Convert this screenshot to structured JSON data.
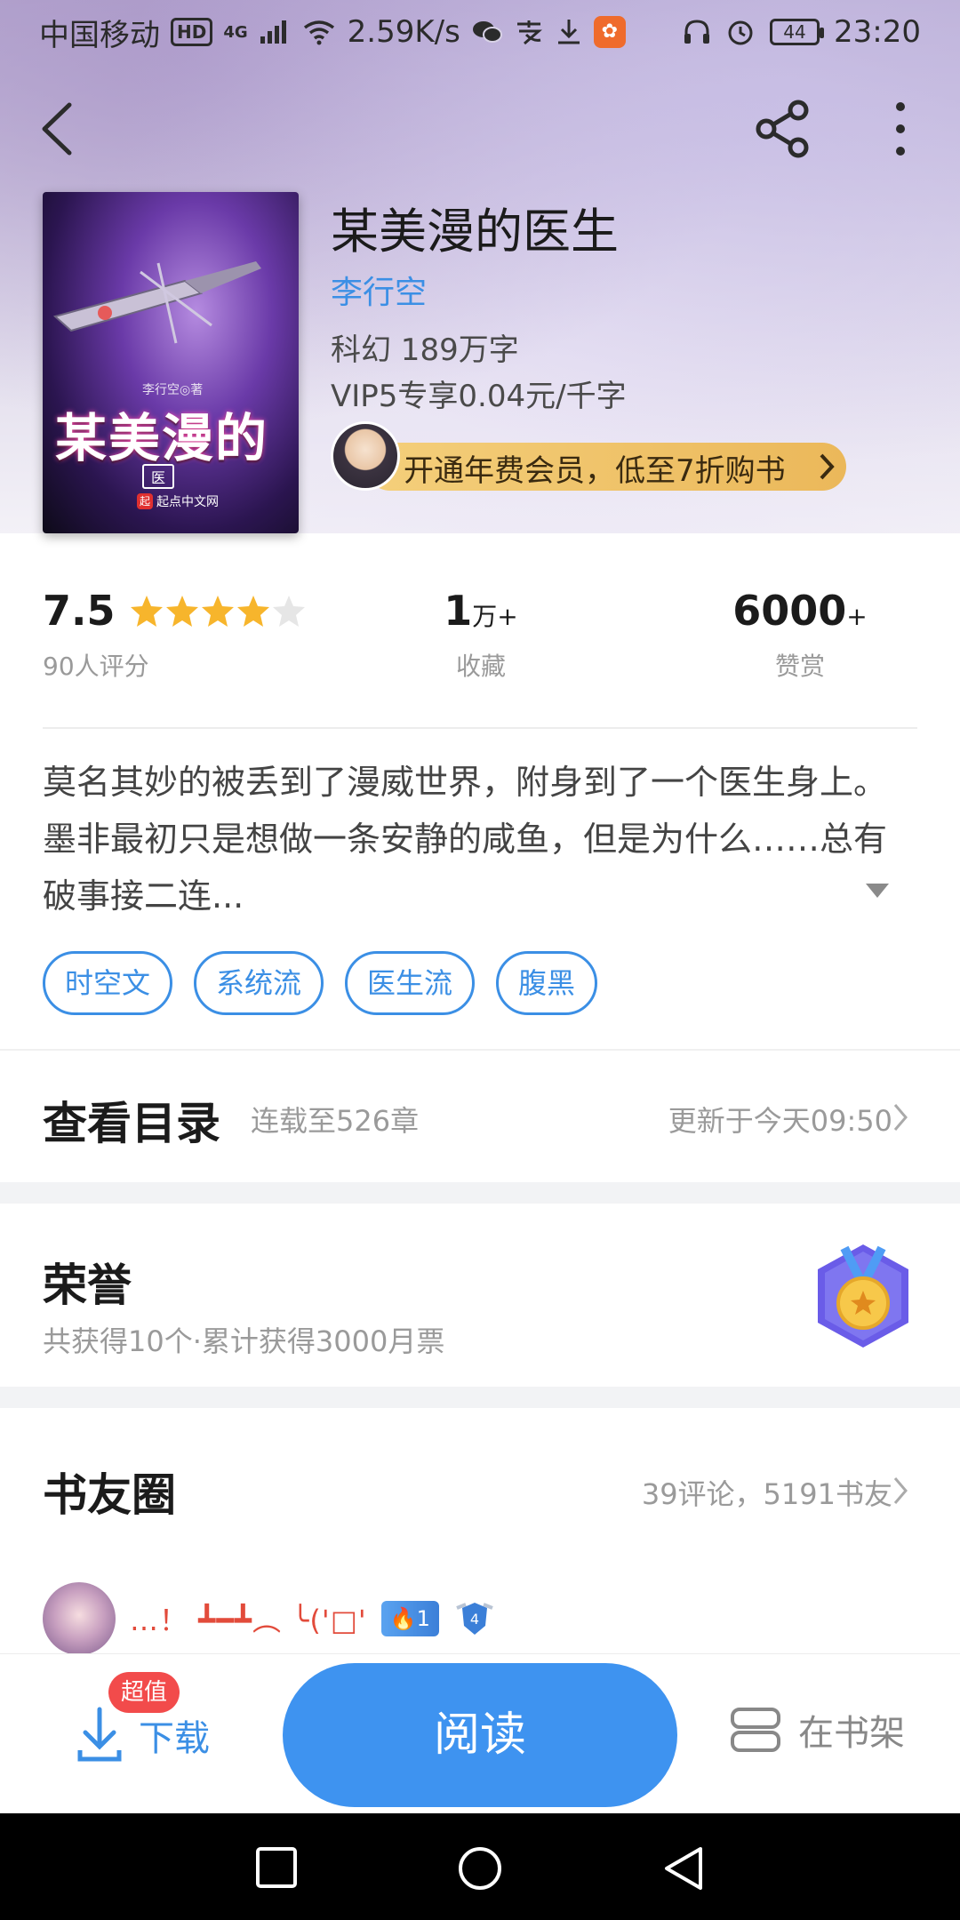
{
  "status_bar": {
    "carrier": "中国移动",
    "hd": "HD",
    "network": "4G",
    "speed": "2.59K/s",
    "battery": "44",
    "time": "23:20"
  },
  "nav": {
    "back_icon": "chevron-left-icon",
    "share_icon": "share-icon",
    "more_icon": "more-vertical-icon"
  },
  "cover": {
    "author_line": "李行空◎著",
    "title": "某美漫的",
    "subtitle": "医",
    "publisher": "起点中文网",
    "publisher_mark": "起"
  },
  "book": {
    "title": "某美漫的医生",
    "author": "李行空",
    "meta_genre_words": "科幻   189万字",
    "meta_price": "VIP5专享0.04元/千字",
    "vip_promo": "开通年费会员，低至7折购书"
  },
  "stats": {
    "score": "7.5",
    "rating_stars": 4,
    "rating_count_label": "90人评分",
    "collect_num": "1",
    "collect_unit": "万+",
    "collect_label": "收藏",
    "reward_num": "6000",
    "reward_unit": "+",
    "reward_label": "赞赏"
  },
  "synopsis": "莫名其妙的被丢到了漫威世界，附身到了一个医生身上。墨非最初只是想做一条安静的咸鱼，但是为什么……总有破事接二连...",
  "tags": [
    "时空文",
    "系统流",
    "医生流",
    "腹黑"
  ],
  "catalog": {
    "title": "查看目录",
    "sub": "连载至526章",
    "updated": "更新于今天09:50"
  },
  "honor": {
    "title": "荣誉",
    "sub": "共获得10个·累计获得3000月票"
  },
  "circle": {
    "title": "书友圈",
    "stats": "39评论，5191书友",
    "comment_name": "…！ ┻━┻︵ ╰('□'",
    "level": "1",
    "shield": "4"
  },
  "actions": {
    "download_label": "下载",
    "download_badge": "超值",
    "read_label": "阅读",
    "shelf_label": "在书架"
  },
  "colors": {
    "accent": "#3e93f0",
    "link": "#3b8fe5",
    "promo": "#ebb85a",
    "badge": "#f24b4b"
  }
}
